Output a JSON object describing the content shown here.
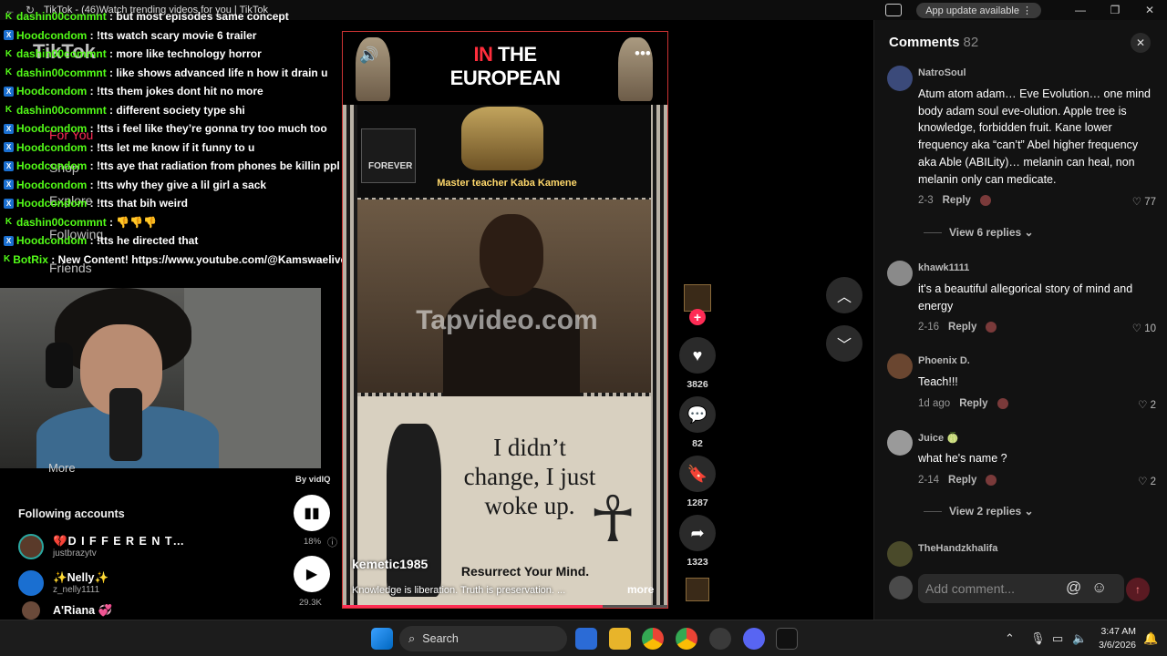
{
  "browser": {
    "tab_title": "TikTok - (46)Watch trending videos for you | TikTok",
    "update_pill": "App update available",
    "update_menu": "⋮"
  },
  "chat": [
    {
      "badge": "k",
      "user": "dashin00commnt",
      "msg": "but most episodes same concept"
    },
    {
      "badge": "x",
      "user": "Hoodcondom",
      "msg": "!tts watch scary movie 6 trailer"
    },
    {
      "badge": "k",
      "user": "dashin00commnt",
      "msg": "more like technology horror"
    },
    {
      "badge": "k",
      "user": "dashin00commnt",
      "msg": "like shows advanced life n how it drain u"
    },
    {
      "badge": "x",
      "user": "Hoodcondom",
      "msg": "!tts them jokes dont hit no more"
    },
    {
      "badge": "k",
      "user": "dashin00commnt",
      "msg": "different society type shi"
    },
    {
      "badge": "x",
      "user": "Hoodcondom",
      "msg": "!tts i feel like they’re gonna try too much too"
    },
    {
      "badge": "x",
      "user": "Hoodcondom",
      "msg": "!tts let me know if it funny to u"
    },
    {
      "badge": "x",
      "user": "Hoodcondom",
      "msg": "!tts aye that radiation from phones be killin ppl"
    },
    {
      "badge": "x",
      "user": "Hoodcondom",
      "msg": "!tts why they give a lil girl a sack"
    },
    {
      "badge": "x",
      "user": "Hoodcondom",
      "msg": "!tts that bih weird"
    },
    {
      "badge": "k",
      "user": "dashin00commnt",
      "msg": "👎👎👎"
    },
    {
      "badge": "x",
      "user": "Hoodcondom",
      "msg": "!tts he directed that"
    },
    {
      "badge": "k",
      "user": "BotRix",
      "msg": "New Content! https://www.youtube.com/@Kamswaelive"
    }
  ],
  "sidebar": {
    "ghost_labels": [
      "TikTok",
      "For You",
      "Shop",
      "Explore",
      "Following",
      "Friends"
    ],
    "more": "More",
    "following_title": "Following accounts",
    "accounts": [
      {
        "name": "💔D I F F E R E N T…",
        "handle": "justbrazytv"
      },
      {
        "name": "✨Nelly✨",
        "handle": "z_nelly1111"
      },
      {
        "name": "A'Riana 💞",
        "handle": ""
      }
    ]
  },
  "vidiq": {
    "label": "By vidIQ",
    "stat1": "18%",
    "stat2": "29.3K"
  },
  "video": {
    "title_red": "IN",
    "title_rest": " THE EUROPEAN",
    "card_text": "FOREVER",
    "master": "Master teacher Kaba Kamene",
    "watermark": "Tapvideo.com",
    "quote": "I didn’t change, I just woke up.",
    "resurrect": "Resurrect Your Mind.",
    "username": "kemetic1985",
    "description": "Knowledge is liberation. Truth is preservation. ...",
    "more": "more",
    "progress": 0.8
  },
  "rail": {
    "likes": "3826",
    "comments": "82",
    "saves": "1287",
    "shares": "1323"
  },
  "comments": {
    "title": "Comments",
    "count": "82",
    "items": [
      {
        "name": "NatroSoul",
        "text": "Atum atom adam… Eve Evolution… one mind body adam soul eve-olution. Apple tree is knowledge, forbidden fruit. Kane lower frequency aka “can’t” Abel higher frequency aka Able (ABILity)… melanin can heal, non melanin only can medicate.",
        "date": "2-3",
        "reply": "Reply",
        "likes": "77",
        "view_replies": "View 6 replies"
      },
      {
        "name": "khawk1111",
        "text": "it's a beautiful allegorical story of mind and energy",
        "date": "2-16",
        "reply": "Reply",
        "likes": "10"
      },
      {
        "name": "Phoenix D.",
        "text": "Teach!!!",
        "date": "1d ago",
        "reply": "Reply",
        "likes": "2"
      },
      {
        "name": "Juice 🍈",
        "text": "what he's name ?",
        "date": "2-14",
        "reply": "Reply",
        "likes": "2",
        "view_replies": "View 2 replies"
      },
      {
        "name": "TheHandzkhalifa",
        "text": ""
      }
    ],
    "add_placeholder": "Add comment..."
  },
  "taskbar": {
    "search": "Search",
    "time": "3:47 AM",
    "date": "3/6/2026"
  },
  "colors": {
    "accent": "#fe2c55",
    "chat_green": "#53fc18"
  }
}
